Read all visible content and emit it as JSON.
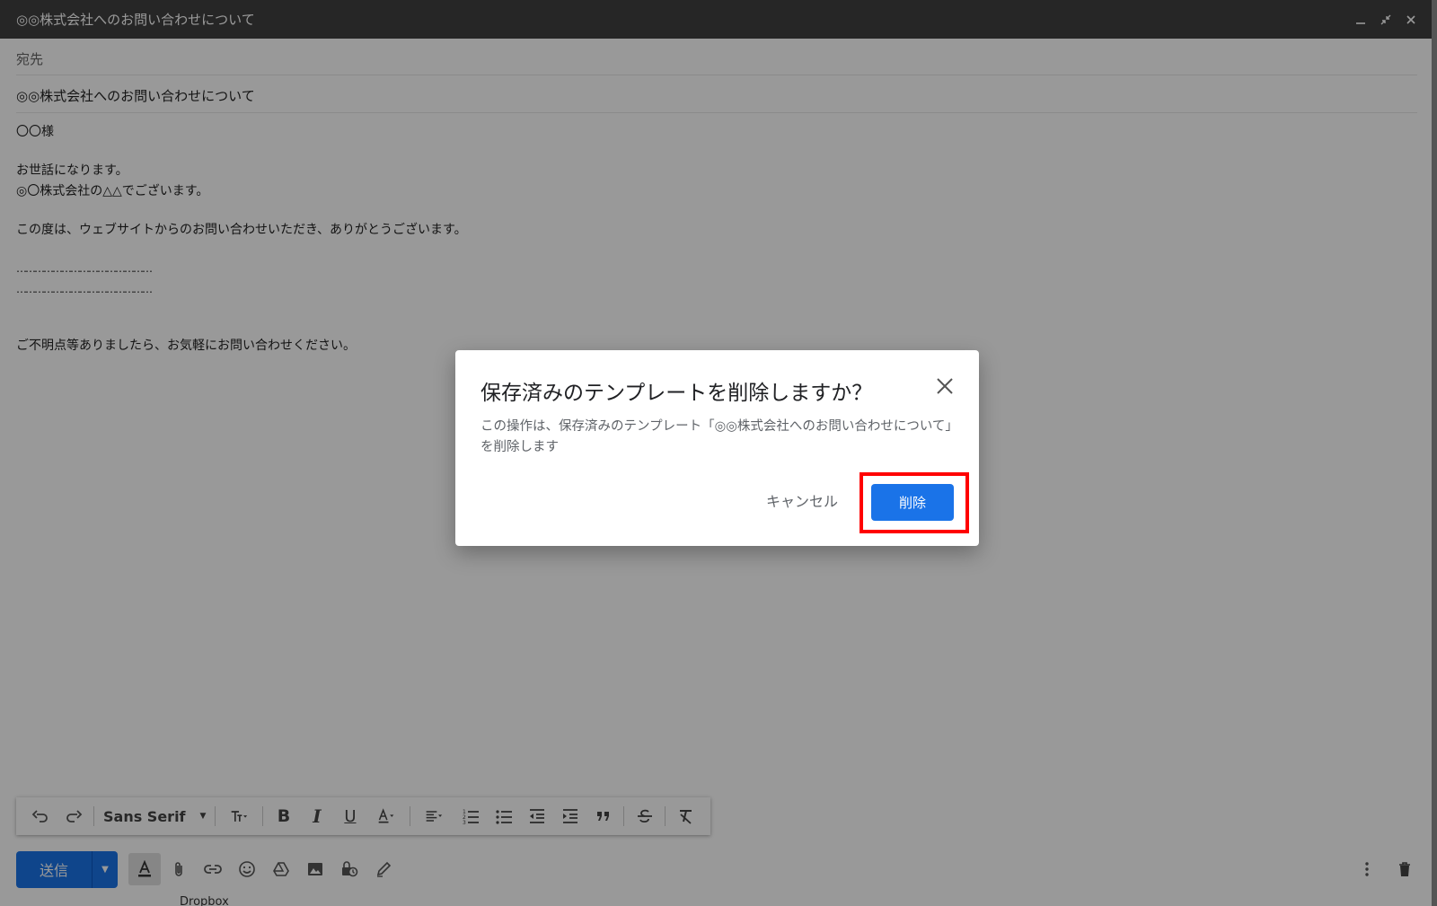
{
  "window": {
    "title": "◎◎株式会社へのお問い合わせについて"
  },
  "compose": {
    "to_label": "宛先",
    "subject": "◎◎株式会社へのお問い合わせについて",
    "body_lines": [
      "〇〇様",
      "",
      "お世話になります。",
      "◎〇株式会社の△△でございます。",
      "",
      "この度は、ウェブサイトからのお問い合わせいただき、ありがとうございます。",
      "",
      "………………………………………",
      "………………………………………",
      "",
      "",
      "ご不明点等ありましたら、お気軽にお問い合わせください。"
    ]
  },
  "format_toolbar": {
    "font_name": "Sans Serif"
  },
  "bottom_bar": {
    "send_label": "送信"
  },
  "background_peek": {
    "text": "Dropbox　　　　　　　　　　　　　　　　　　　　　　　　　　　　　　　　　　　　　　　　　　　　　　　　　　　　　　　　　　　　　　　　　　　　　　　　　　　　　　　　　　　　"
  },
  "dialog": {
    "title": "保存済みのテンプレートを削除しますか？",
    "message": "この操作は、保存済みのテンプレート「◎◎株式会社へのお問い合わせについて」を削除します",
    "cancel_label": "キャンセル",
    "delete_label": "削除"
  },
  "colors": {
    "primary": "#1a73e8",
    "highlight": "#ff0000",
    "titlebar": "#404040"
  }
}
